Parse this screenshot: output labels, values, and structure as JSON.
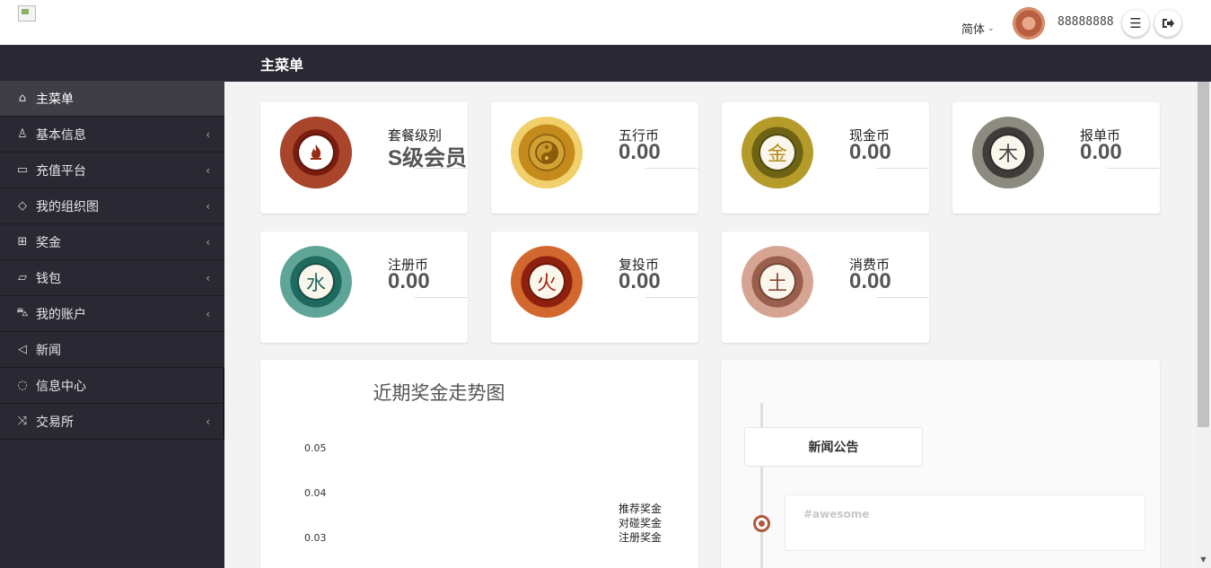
{
  "header": {
    "language": "简体",
    "username": "88888888"
  },
  "titlebar": {
    "title": "主菜单"
  },
  "sidebar": {
    "items": [
      {
        "label": "主菜单",
        "icon": "home-icon",
        "has_arrow": false
      },
      {
        "label": "基本信息",
        "icon": "user-icon",
        "has_arrow": true
      },
      {
        "label": "充值平台",
        "icon": "credit-card-icon",
        "has_arrow": true
      },
      {
        "label": "我的组织图",
        "icon": "tag-icon",
        "has_arrow": true
      },
      {
        "label": "奖金",
        "icon": "gift-icon",
        "has_arrow": true
      },
      {
        "label": "钱包",
        "icon": "folder-icon",
        "has_arrow": true
      },
      {
        "label": "我的账户",
        "icon": "cart-icon",
        "has_arrow": true
      },
      {
        "label": "新闻",
        "icon": "megaphone-icon",
        "has_arrow": false
      },
      {
        "label": "信息中心",
        "icon": "chat-icon",
        "has_arrow": false
      },
      {
        "label": "交易所",
        "icon": "shuffle-icon",
        "has_arrow": true
      }
    ]
  },
  "cards": [
    {
      "label": "套餐级别",
      "value": "S级会员",
      "coin_char": "",
      "coin": "fire-coin-icon"
    },
    {
      "label": "五行币",
      "value": "0.00",
      "coin_char": "",
      "coin": "bagua-coin-icon"
    },
    {
      "label": "现金币",
      "value": "0.00",
      "coin_char": "金",
      "coin": "jin-coin-icon"
    },
    {
      "label": "报单币",
      "value": "0.00",
      "coin_char": "木",
      "coin": "mu-coin-icon"
    },
    {
      "label": "注册币",
      "value": "0.00",
      "coin_char": "水",
      "coin": "shui-coin-icon"
    },
    {
      "label": "复投币",
      "value": "0.00",
      "coin_char": "火",
      "coin": "huo-coin-icon"
    },
    {
      "label": "消费币",
      "value": "0.00",
      "coin_char": "土",
      "coin": "tu-coin-icon"
    }
  ],
  "chart_data": {
    "type": "line",
    "title": "近期奖金走势图",
    "y_ticks": [
      "0.05",
      "0.04",
      "0.03"
    ],
    "series": [
      {
        "name": "推荐奖金",
        "values": []
      },
      {
        "name": "对碰奖金",
        "values": []
      },
      {
        "name": "注册奖金",
        "values": []
      }
    ]
  },
  "news": {
    "heading": "新闻公告",
    "items": [
      {
        "text": "#awesome"
      }
    ]
  }
}
